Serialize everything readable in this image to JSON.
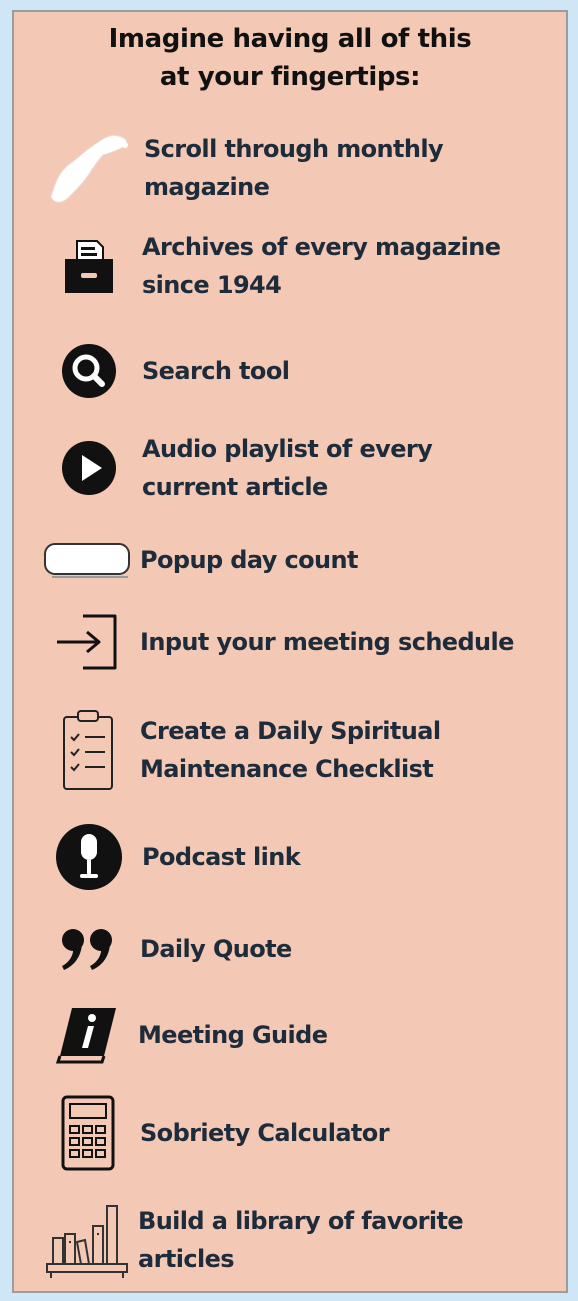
{
  "title_line1": "Imagine having all of this",
  "title_line2": "at your fingertips:",
  "features": [
    {
      "icon": "hand-swipe-icon",
      "line1": "Scroll through monthly",
      "line2": "magazine"
    },
    {
      "icon": "file-archive-box-icon",
      "line1": "Archives of every magazine",
      "line2": "since 1944"
    },
    {
      "icon": "search-icon",
      "line1": "Search tool",
      "line2": ""
    },
    {
      "icon": "play-icon",
      "line1": "Audio playlist of every",
      "line2": "current article"
    },
    {
      "icon": "popup-box-icon",
      "line1": "Popup day count",
      "line2": ""
    },
    {
      "icon": "sign-in-icon",
      "line1": "Input your meeting schedule",
      "line2": ""
    },
    {
      "icon": "clipboard-checklist-icon",
      "line1": "Create a Daily Spiritual",
      "line2": "Maintenance Checklist"
    },
    {
      "icon": "microphone-icon",
      "line1": "Podcast link",
      "line2": ""
    },
    {
      "icon": "quote-icon",
      "line1": "Daily Quote",
      "line2": ""
    },
    {
      "icon": "info-book-icon",
      "line1": "Meeting Guide",
      "line2": ""
    },
    {
      "icon": "calculator-icon",
      "line1": "Sobriety Calculator",
      "line2": ""
    },
    {
      "icon": "bookshelf-icon",
      "line1": "Build a library of favorite",
      "line2": "articles"
    }
  ]
}
